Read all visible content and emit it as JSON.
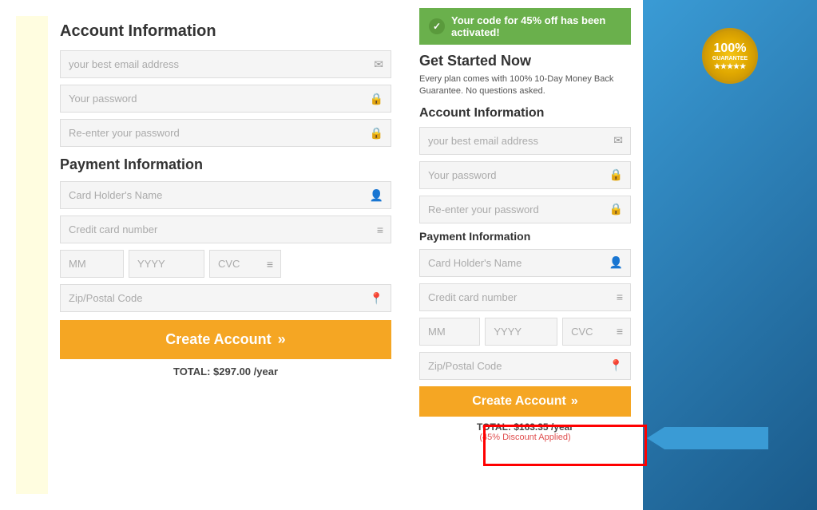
{
  "left": {
    "account_section_title": "Account Information",
    "email_placeholder": "your best email address",
    "password_placeholder": "Your password",
    "reenter_placeholder": "Re-enter your password",
    "payment_section_title": "Payment Information",
    "cardholder_placeholder": "Card Holder's Name",
    "card_number_placeholder": "Credit card number",
    "mm_placeholder": "MM",
    "yyyy_placeholder": "YYYY",
    "cvc_placeholder": "CVC",
    "zip_placeholder": "Zip/Postal Code",
    "create_btn_label": "Create Account",
    "create_btn_icon": "»",
    "total_label": "TOTAL: $297.00 /year"
  },
  "right": {
    "discount_banner": "Your code for 45% off has been activated!",
    "get_started_title": "Get Started Now",
    "get_started_sub": "Every plan comes with 100% 10-Day Money Back Guarantee. No questions asked.",
    "badge_line1": "100%",
    "badge_line2": "GUARANTEE",
    "account_section_title": "Account Information",
    "email_placeholder": "your best email address",
    "password_placeholder": "Your password",
    "reenter_placeholder": "Re-enter your password",
    "payment_section_title": "Payment Information",
    "cardholder_placeholder": "Card Holder's Name",
    "card_number_placeholder": "Credit card number",
    "mm_placeholder": "MM",
    "yyyy_placeholder": "YYYY",
    "cvc_placeholder": "CVC",
    "zip_placeholder": "Zip/Postal Code",
    "create_btn_label": "Create Account",
    "create_btn_icon": "»",
    "total_label": "TOTAL: $163.35 /year",
    "discount_applied": "(45% Discount Applied)"
  }
}
